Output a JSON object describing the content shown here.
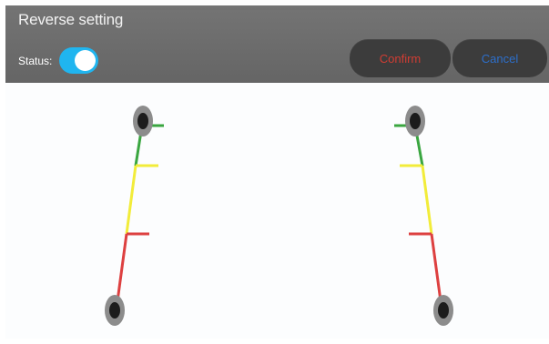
{
  "header": {
    "title": "Reverse setting",
    "status_label": "Status:",
    "status_on": true,
    "confirm_label": "Confirm",
    "cancel_label": "Cancel"
  },
  "colors": {
    "header_bg": "#6b6b6b",
    "toggle_on": "#20b5ef",
    "button_bg": "#3c3c3c",
    "confirm_text": "#d13d33",
    "cancel_text": "#2d6fcb",
    "guide_green": "#3aa640",
    "guide_yellow": "#f2ec3a",
    "guide_red": "#dd4040",
    "handle_outer": "#8c8c8c",
    "handle_inner": "#1c1c1c"
  },
  "guidelines": [
    {
      "name": "left",
      "handles": 2,
      "segments": [
        "green",
        "yellow",
        "red"
      ]
    },
    {
      "name": "right",
      "handles": 2,
      "segments": [
        "green",
        "yellow",
        "red"
      ]
    }
  ]
}
